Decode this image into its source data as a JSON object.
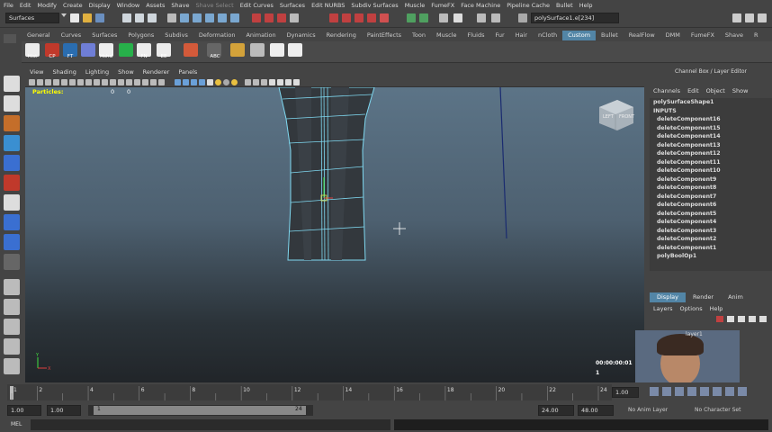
{
  "menubar": [
    "File",
    "Edit",
    "Modify",
    "Create",
    "Display",
    "Window",
    "Assets",
    "Shave",
    "Shave Select",
    "Edit Curves",
    "Surfaces",
    "Edit NURBS",
    "Subdiv Surfaces",
    "Muscle",
    "FumeFX",
    "Face Machine",
    "Pipeline Cache",
    "Bullet",
    "Help"
  ],
  "status": {
    "mode": "Surfaces",
    "selection_field": "polySurface1.e[234]"
  },
  "shelf_tabs": [
    "General",
    "Curves",
    "Surfaces",
    "Polygons",
    "Subdivs",
    "Deformation",
    "Animation",
    "Dynamics",
    "Rendering",
    "PaintEffects",
    "Toon",
    "Muscle",
    "Fluids",
    "Fur",
    "Hair",
    "nCloth",
    "Custom",
    "Bullet",
    "RealFlow",
    "DMM",
    "FumeFX",
    "Shave",
    "R"
  ],
  "active_shelf_tab": "Custom",
  "shelf_buttons": [
    "Hist",
    "CP",
    "FT",
    "",
    "Hshd",
    "",
    "FN",
    "EE",
    "",
    "ABC",
    "",
    ""
  ],
  "panel_menu": [
    "View",
    "Shading",
    "Lighting",
    "Show",
    "Renderer",
    "Panels"
  ],
  "viewport": {
    "particles_label": "Particles:",
    "particles_values": [
      "0",
      "0"
    ],
    "view_cube_labels": [
      "LEFT",
      "FRONT"
    ],
    "timecode": "00:00:00:01",
    "frame": "1",
    "axis_labels": [
      "Y",
      "X"
    ]
  },
  "channel_box": {
    "title": "Channel Box / Layer Editor",
    "menus": [
      "Channels",
      "Edit",
      "Object",
      "Show"
    ],
    "shape": "polySurfaceShape1",
    "inputs_label": "INPUTS",
    "items": [
      "deleteComponent16",
      "deleteComponent15",
      "deleteComponent14",
      "deleteComponent13",
      "deleteComponent12",
      "deleteComponent11",
      "deleteComponent10",
      "deleteComponent9",
      "deleteComponent8",
      "deleteComponent7",
      "deleteComponent6",
      "deleteComponent5",
      "deleteComponent4",
      "deleteComponent3",
      "deleteComponent2",
      "deleteComponent1",
      "polyBoolOp1"
    ]
  },
  "layer_panel": {
    "tabs": [
      "Display",
      "Render",
      "Anim"
    ],
    "active_tab": "Display",
    "menus": [
      "Layers",
      "Options",
      "Help"
    ],
    "layer_name": "layer1"
  },
  "timeline": {
    "ticks": [
      "1",
      "2",
      "4",
      "6",
      "8",
      "10",
      "12",
      "14",
      "16",
      "18",
      "20",
      "22",
      "24"
    ],
    "current": "1.00"
  },
  "range": {
    "start": "1.00",
    "start2": "1.00",
    "range_start": "1",
    "range_end": "24",
    "end": "24.00",
    "end2": "48.00",
    "anim_layer": "No Anim Layer",
    "char_set": "No Character Set"
  },
  "cmdline": {
    "label": "MEL"
  },
  "colors": {
    "accent": "#5285a6",
    "mesh": "#7fd8f0",
    "ui_bg": "#444444"
  }
}
